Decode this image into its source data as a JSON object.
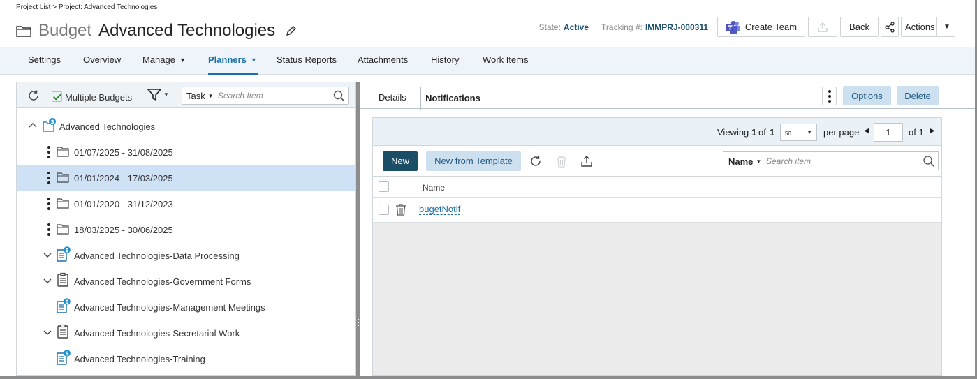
{
  "breadcrumb": "Project List > Project: Advanced Technologies",
  "header": {
    "type": "Budget",
    "name": "Advanced Technologies",
    "state_label": "State:",
    "state_value": "Active",
    "tracking_label": "Tracking #:",
    "tracking_value": "IMMPRJ-000311",
    "create_team": "Create Team",
    "back": "Back",
    "actions": "Actions"
  },
  "nav": {
    "items": [
      "Settings",
      "Overview",
      "Manage",
      "Planners",
      "Status Reports",
      "Attachments",
      "History",
      "Work Items"
    ],
    "active": "Planners"
  },
  "left": {
    "multiple_budgets": "Multiple Budgets",
    "search_scope": "Task",
    "search_placeholder": "Search Item",
    "tree": [
      {
        "label": "Advanced Technologies"
      },
      {
        "label": "01/07/2025 - 31/08/2025"
      },
      {
        "label": "01/01/2024 - 17/03/2025",
        "selected": true
      },
      {
        "label": "01/01/2020 - 31/12/2023"
      },
      {
        "label": "18/03/2025 - 30/06/2025"
      },
      {
        "label": "Advanced Technologies-Data Processing"
      },
      {
        "label": "Advanced Technologies-Government Forms"
      },
      {
        "label": "Advanced Technologies-Management Meetings"
      },
      {
        "label": "Advanced Technologies-Secretarial Work"
      },
      {
        "label": "Advanced Technologies-Training"
      }
    ]
  },
  "right": {
    "tabs": [
      "Details",
      "Notifications"
    ],
    "active_tab": "Notifications",
    "options": "Options",
    "delete": "Delete",
    "pager": {
      "viewing": "Viewing",
      "from": "1",
      "of_word": "of",
      "to": "1",
      "page_size": "50",
      "per_page": "per page",
      "page": "1",
      "of_pages": "of 1"
    },
    "new": "New",
    "new_from_template": "New from Template",
    "search_scope": "Name",
    "search_placeholder": "Search item",
    "column_name": "Name",
    "rows": [
      {
        "name": "bugetNotif"
      }
    ]
  },
  "colors": {
    "accent": "#1b6fa7",
    "nav_bg": "#eef4f9",
    "selected_row": "#cfe1f5",
    "primary_button": "#1b4e66",
    "secondary_button": "#cde0f0"
  }
}
